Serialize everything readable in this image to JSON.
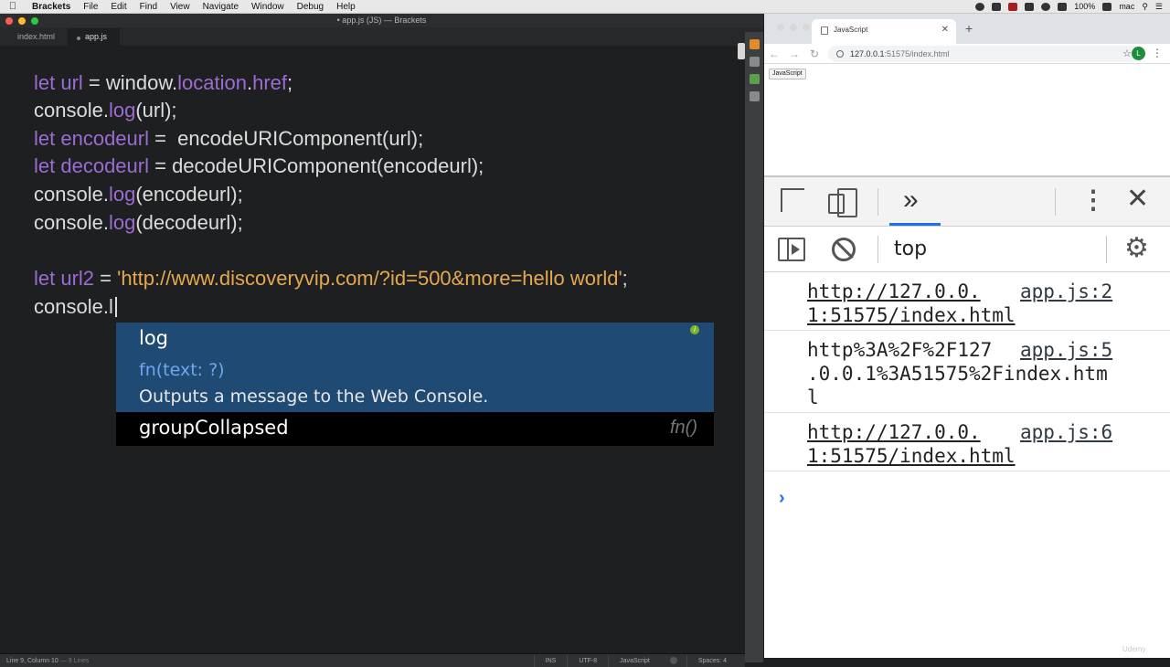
{
  "menubar": {
    "app": "Brackets",
    "items": [
      "File",
      "Edit",
      "Find",
      "View",
      "Navigate",
      "Window",
      "Debug",
      "Help"
    ],
    "battery": "100%",
    "user": "mac"
  },
  "brackets": {
    "title": "• app.js (JS) — Brackets",
    "tabs": [
      "index.html",
      "app.js"
    ],
    "code": {
      "l1": {
        "a": "let ",
        "b": "url",
        "c": " = window.",
        "d": "location",
        "e": ".",
        "f": "href",
        "g": ";"
      },
      "l2": {
        "a": "console.",
        "b": "log",
        "c": "(url);"
      },
      "l3": {
        "a": "let ",
        "b": "encodeurl",
        "c": " =  encodeURIComponent(url);"
      },
      "l4": {
        "a": "let ",
        "b": "decodeurl",
        "c": " = decodeURIComponent(encodeurl);"
      },
      "l5": {
        "a": "console.",
        "b": "log",
        "c": "(encodeurl);"
      },
      "l6": {
        "a": "console.",
        "b": "log",
        "c": "(decodeurl);"
      },
      "l8": {
        "a": "let ",
        "b": "url2",
        "c": " = ",
        "d": "'http://www.discoveryvip.com/?id=500&more=hello world'",
        "e": ";"
      },
      "l9": {
        "a": "console.l"
      }
    },
    "hint": {
      "name": "log",
      "signature": "fn(text: ?)",
      "description": "Outputs a message to the Web Console.",
      "info_icon": "i",
      "second_name": "groupCollapsed",
      "second_type": "fn()"
    },
    "status": {
      "position": "Line 9, Column 10",
      "lines": " — 9 Lines",
      "mode": "INS",
      "encoding": "UTF-8",
      "language": "JavaScript",
      "spaces": "Spaces: 4"
    }
  },
  "chrome": {
    "tab_title": "JavaScript",
    "url_host": "127.0.0.1",
    "url_rest": ":51575/index.html",
    "avatar": "L",
    "page_button": "JavaScript",
    "devtools": {
      "context": "top",
      "messages": [
        {
          "text": "http://127.0.0.\n1:51575/index.html",
          "source": "app.js:2",
          "link": true
        },
        {
          "text": "http%3A%2F%2F127\n.0.0.1%3A51575%2Findex.htm\nl",
          "source": "app.js:5",
          "link": false
        },
        {
          "text": "http://127.0.0.\n1:51575/index.html",
          "source": "app.js:6",
          "link": true
        }
      ]
    },
    "watermark": "Udemy"
  }
}
